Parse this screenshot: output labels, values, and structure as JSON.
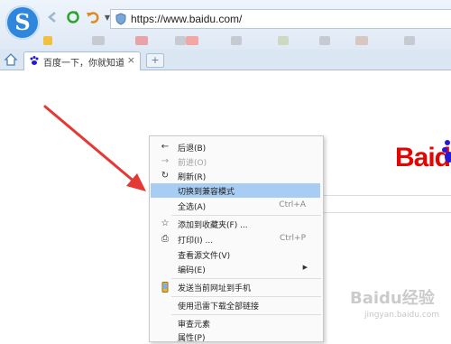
{
  "browser": {
    "url": "https://www.baidu.com/",
    "tab_title": "百度一下，你就知道",
    "tab_close": "×",
    "new_tab": "+"
  },
  "page": {
    "logo_text": "Baid"
  },
  "context_menu": {
    "items": [
      {
        "icon": "back-arrow-icon",
        "label": "后退(B)",
        "shortcut": "",
        "disabled": false
      },
      {
        "icon": "forward-arrow-icon",
        "label": "前进(O)",
        "shortcut": "",
        "disabled": true
      },
      {
        "icon": "refresh-icon",
        "label": "刷新(R)",
        "shortcut": "",
        "disabled": false
      },
      {
        "icon": "",
        "label": "切换到兼容模式",
        "shortcut": "",
        "disabled": false,
        "highlighted": true
      },
      {
        "icon": "",
        "label": "全选(A)",
        "shortcut": "Ctrl+A",
        "disabled": false
      },
      {
        "icon": "star-icon",
        "label": "添加到收藏夹(F) ...",
        "shortcut": "",
        "disabled": false
      },
      {
        "icon": "printer-icon",
        "label": "打印(I) ...",
        "shortcut": "Ctrl+P",
        "disabled": false
      },
      {
        "icon": "",
        "label": "查看源文件(V)",
        "shortcut": "",
        "disabled": false
      },
      {
        "icon": "",
        "label": "编码(E)",
        "shortcut": "",
        "submenu": true,
        "disabled": false
      },
      {
        "icon": "phone-icon",
        "label": "发送当前网址到手机",
        "shortcut": "",
        "disabled": false
      },
      {
        "icon": "",
        "label": "使用迅雷下载全部链接",
        "shortcut": "",
        "disabled": false
      },
      {
        "icon": "",
        "label": "审查元素",
        "shortcut": "",
        "disabled": false
      },
      {
        "icon": "",
        "label": "属性(P)",
        "shortcut": "",
        "disabled": false
      }
    ]
  },
  "watermark": {
    "main": "Baidu经验",
    "sub": "jingyan.baidu.com"
  },
  "colors": {
    "highlight": "#a8cdf3",
    "annotation_arrow": "#e53935",
    "baidu_red": "#e10601",
    "baidu_blue": "#2319dc"
  }
}
